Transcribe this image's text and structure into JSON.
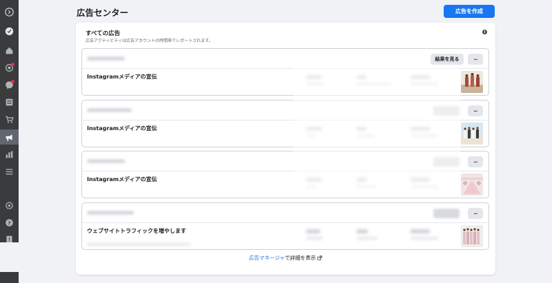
{
  "header": {
    "title": "広告センター",
    "create_button": "広告を作成"
  },
  "panel": {
    "title": "すべての広告",
    "subtitle": "広告アクティビティは広告アカウントの時間帯でレポートされます。",
    "info_icon": "i"
  },
  "cards": [
    {
      "ad_name": "Instagramメディアの宣伝",
      "results_button": "結果を見る",
      "more_label": "···"
    },
    {
      "ad_name": "Instagramメディアの宣伝",
      "more_label": "···"
    },
    {
      "ad_name": "Instagramメディアの宣伝",
      "more_label": "···"
    },
    {
      "ad_name": "ウェブサイトトラフィックを増やします",
      "more_label": "···"
    }
  ],
  "footer": {
    "link_text": "広告マネージャ",
    "rest_text": "で詳細を表示"
  },
  "colors": {
    "accent": "#1877f2",
    "sidebar": "#3a3b3c",
    "notification": "#f02849"
  },
  "sidebar_icons": [
    "arrow-circle-icon",
    "logo-icon",
    "home-icon",
    "instagram-icon",
    "messenger-icon",
    "pages-icon",
    "shop-icon",
    "ads-icon",
    "insights-icon",
    "menu-icon",
    "settings-icon",
    "help-icon",
    "report-icon"
  ]
}
